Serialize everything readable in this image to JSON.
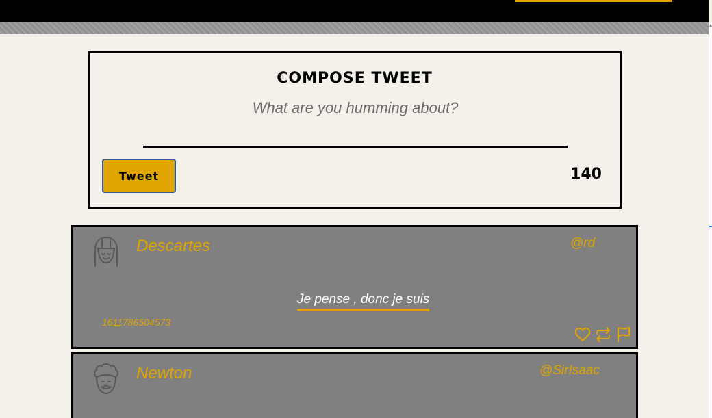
{
  "compose": {
    "title": "Compose Tweet",
    "placeholder": "What are you humming about?",
    "tweet_button_label": "Tweet",
    "char_count": "140"
  },
  "tweets": [
    {
      "name": "Descartes",
      "handle": "@rd",
      "text": "Je pense , donc je suis",
      "timestamp": "1611786504573",
      "avatar_icon": "girl-face-icon"
    },
    {
      "name": "Newton",
      "handle": "@SirIsaac",
      "avatar_icon": "curly-hair-face-icon"
    }
  ],
  "icons": [
    "heart-icon",
    "retweet-icon",
    "flag-icon"
  ],
  "colors": {
    "accent": "#e0a500",
    "card_bg": "#808080",
    "page_bg": "#f4f1ea"
  }
}
